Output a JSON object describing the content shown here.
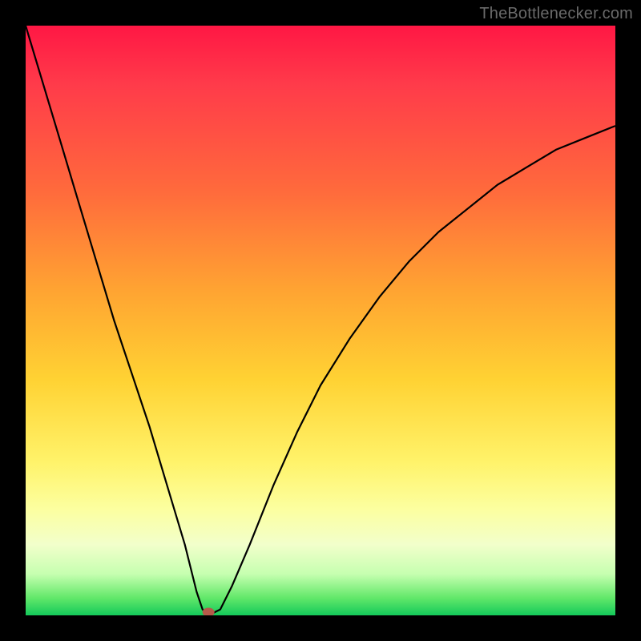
{
  "watermark": {
    "text": "TheBottlenecker.com"
  },
  "chart_data": {
    "type": "line",
    "title": "",
    "xlabel": "",
    "ylabel": "",
    "xlim": [
      0,
      100
    ],
    "ylim": [
      0,
      100
    ],
    "note": "V-shaped bottleneck curve over a vertical spectrum gradient (red at top, green at bottom). Minimum near x≈31. Values estimated from pixel positions.",
    "series": [
      {
        "name": "curve",
        "x": [
          0,
          3,
          6,
          9,
          12,
          15,
          18,
          21,
          24,
          27,
          29,
          30,
          31,
          33,
          35,
          38,
          42,
          46,
          50,
          55,
          60,
          65,
          70,
          75,
          80,
          85,
          90,
          95,
          100
        ],
        "y": [
          100,
          90,
          80,
          70,
          60,
          50,
          41,
          32,
          22,
          12,
          4,
          1,
          0,
          1,
          5,
          12,
          22,
          31,
          39,
          47,
          54,
          60,
          65,
          69,
          73,
          76,
          79,
          81,
          83
        ]
      }
    ],
    "marker": {
      "x": 31,
      "y": 0,
      "color": "#b55a4a"
    },
    "background_gradient": [
      "#ff1744",
      "#ff6a3c",
      "#ffd233",
      "#fcffa0",
      "#14c95a"
    ]
  }
}
